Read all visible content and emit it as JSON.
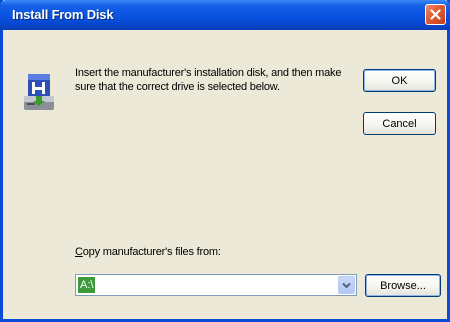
{
  "window": {
    "title": "Install From Disk",
    "close_icon": "close-icon"
  },
  "message": "Insert the manufacturer's installation disk, and then make sure that the correct drive is selected below.",
  "buttons": {
    "ok_label": "OK",
    "cancel_label": "Cancel",
    "browse_label": "Browse..."
  },
  "copy_files": {
    "label_mnemonic": "C",
    "label_rest": "opy manufacturer's files from:",
    "value": "A:\\"
  },
  "icons": {
    "disk": "install-disk-icon",
    "dropdown": "chevron-down-icon"
  },
  "colors": {
    "titlebar": "#0a52e0",
    "close": "#e05a30",
    "selection": "#3c9a3c",
    "dialog_bg": "#ece9d8"
  }
}
